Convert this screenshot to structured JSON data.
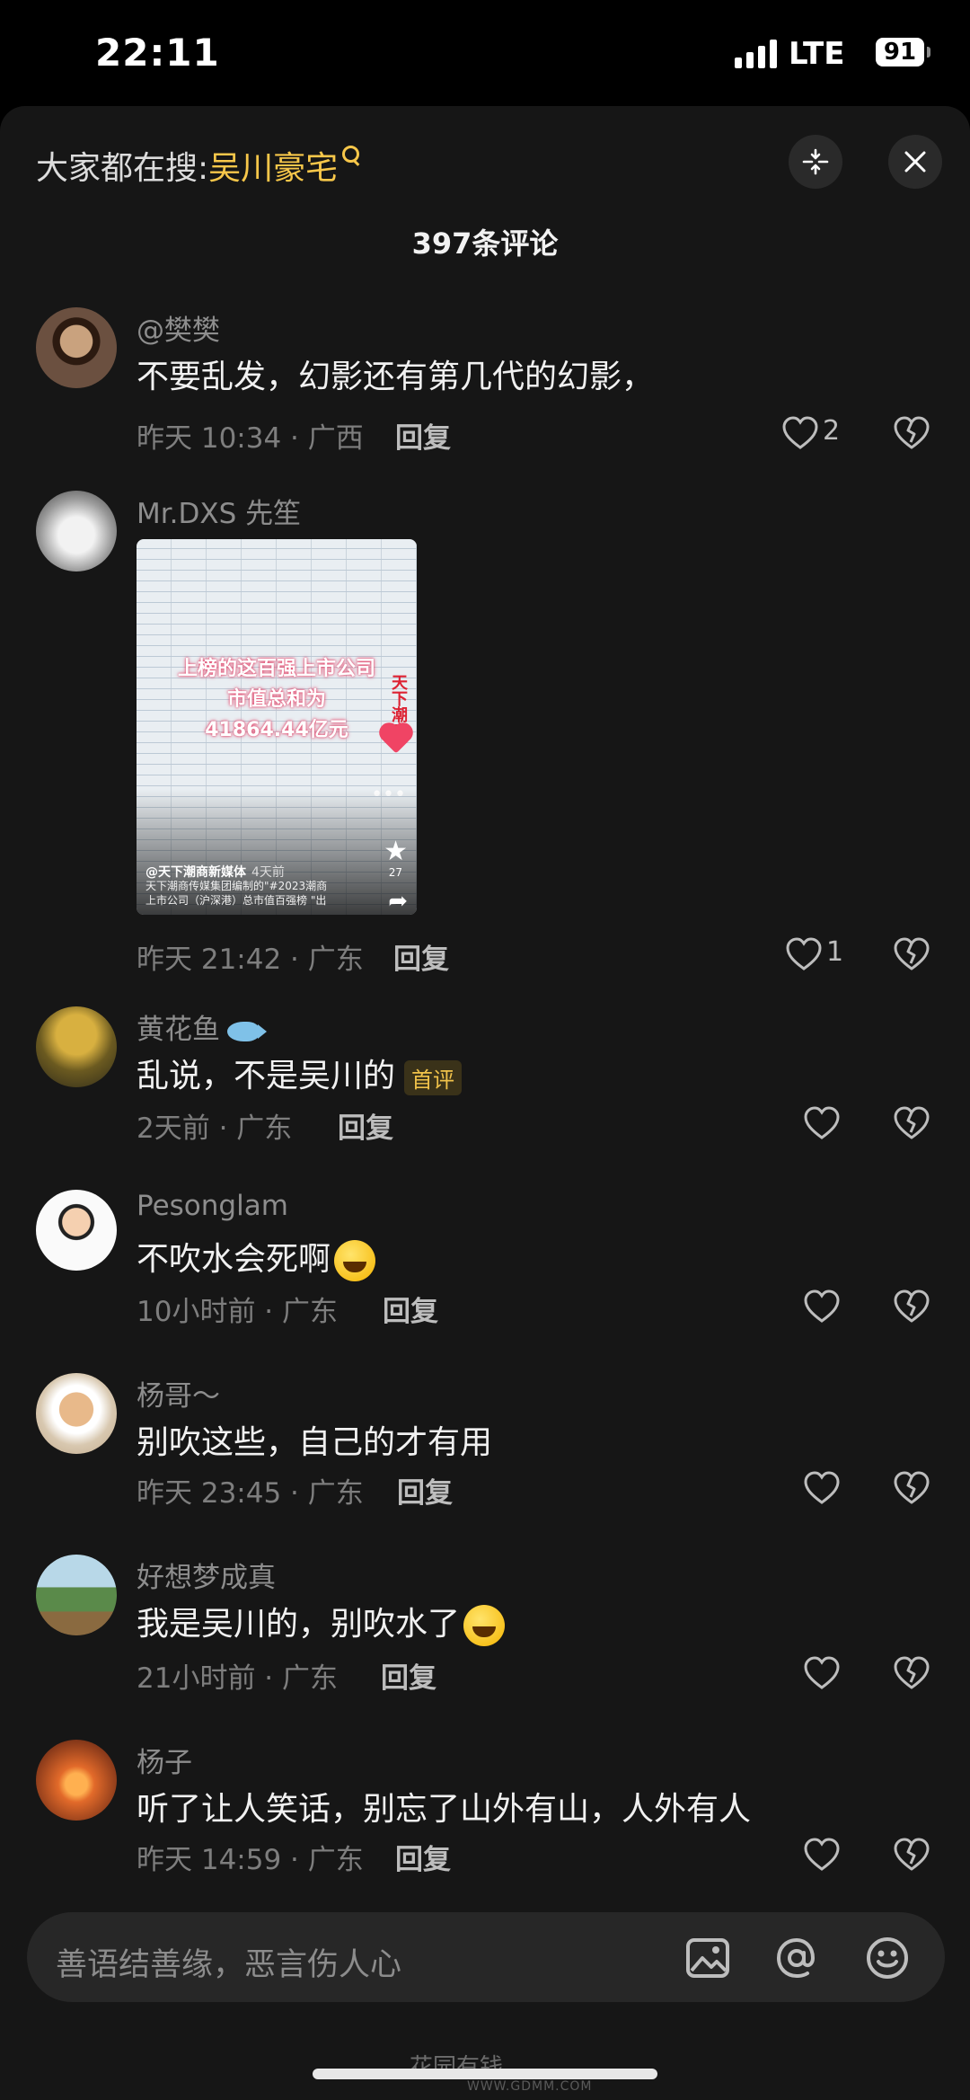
{
  "status_bar": {
    "time": "22:11",
    "network": "LTE",
    "battery": "91"
  },
  "header": {
    "search_prefix": "大家都在搜:",
    "search_keyword": "吴川豪宅",
    "comment_count": "397条评论"
  },
  "comments": [
    {
      "user": "@樊樊",
      "text": "不要乱发，幻影还有第几代的幻影，",
      "time": "昨天 10:34 · 广西",
      "reply": "回复",
      "likes": "2"
    },
    {
      "user": "Mr.DXS 先笙",
      "text": "",
      "time": "昨天 21:42 · 广东",
      "reply": "回复",
      "likes": "1",
      "video": {
        "line1": "上榜的这百强上市公司",
        "line2": "市值总和为",
        "line3": "41864.44亿元",
        "side_text": "天下潮商",
        "author": "@天下潮商新媒体",
        "age": "4天前",
        "desc_line1": "天下潮商传媒集团编制的\"#2023潮商",
        "desc_line2": "上市公司（沪深港）总市值百强榜 \"出",
        "star_count": "27"
      }
    },
    {
      "user": "黄花鱼",
      "text": "乱说，不是吴川的",
      "badge": "首评",
      "time": "2天前 · 广东",
      "reply": "回复",
      "likes": ""
    },
    {
      "user": "Pesonglam",
      "text": "不吹水会死啊",
      "time": "10小时前 · 广东",
      "reply": "回复",
      "likes": ""
    },
    {
      "user": "杨哥～",
      "text": "别吹这些，自己的才有用",
      "time": "昨天 23:45 · 广东",
      "reply": "回复",
      "likes": ""
    },
    {
      "user": "好想梦成真",
      "text": "我是吴川的，别吹水了",
      "time": "21小时前 · 广东",
      "reply": "回复",
      "likes": ""
    },
    {
      "user": "杨子",
      "text": "听了让人笑话，别忘了山外有山，人外有人",
      "time": "昨天 14:59 · 广东",
      "reply": "回复",
      "likes": ""
    }
  ],
  "input": {
    "placeholder": "善语结善缘，恶言伤人心"
  },
  "watermark": {
    "main": "花园有钱",
    "sub": "WWW.GDMM.COM"
  },
  "colors": {
    "accent": "#f7c74a",
    "sheet_bg": "#161616",
    "input_bg": "#272727"
  }
}
